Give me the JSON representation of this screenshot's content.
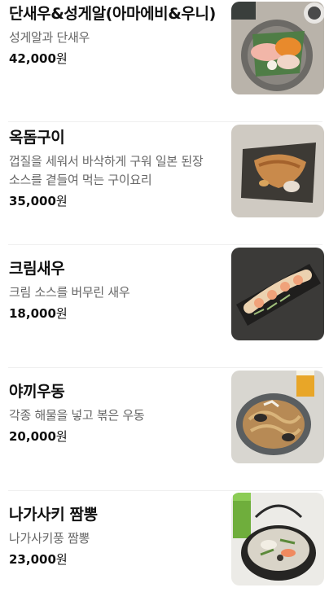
{
  "menu": {
    "currency_suffix": "원",
    "items": [
      {
        "name": "단새우&성게알(아마에비&우니)",
        "description": "성게알과 단새우",
        "price": "42,000",
        "image_icon": "sashimi-plate-photo"
      },
      {
        "name": "옥돔구이",
        "description": "껍질을 세워서 바삭하게 구워 일본 된장 소스를 곁들여 먹는 구이요리",
        "price": "35,000",
        "image_icon": "grilled-fish-photo"
      },
      {
        "name": "크림새우",
        "description": "크림 소스를 버무린 새우",
        "price": "18,000",
        "image_icon": "cream-shrimp-photo"
      },
      {
        "name": "야끼우동",
        "description": "각종 해물을 넣고 볶은 우동",
        "price": "20,000",
        "image_icon": "stir-fried-udon-photo"
      },
      {
        "name": "나가사키 짬뽕",
        "description": "나가사키풍 짬뽕",
        "price": "23,000",
        "image_icon": "nagasaki-champon-photo"
      }
    ]
  }
}
